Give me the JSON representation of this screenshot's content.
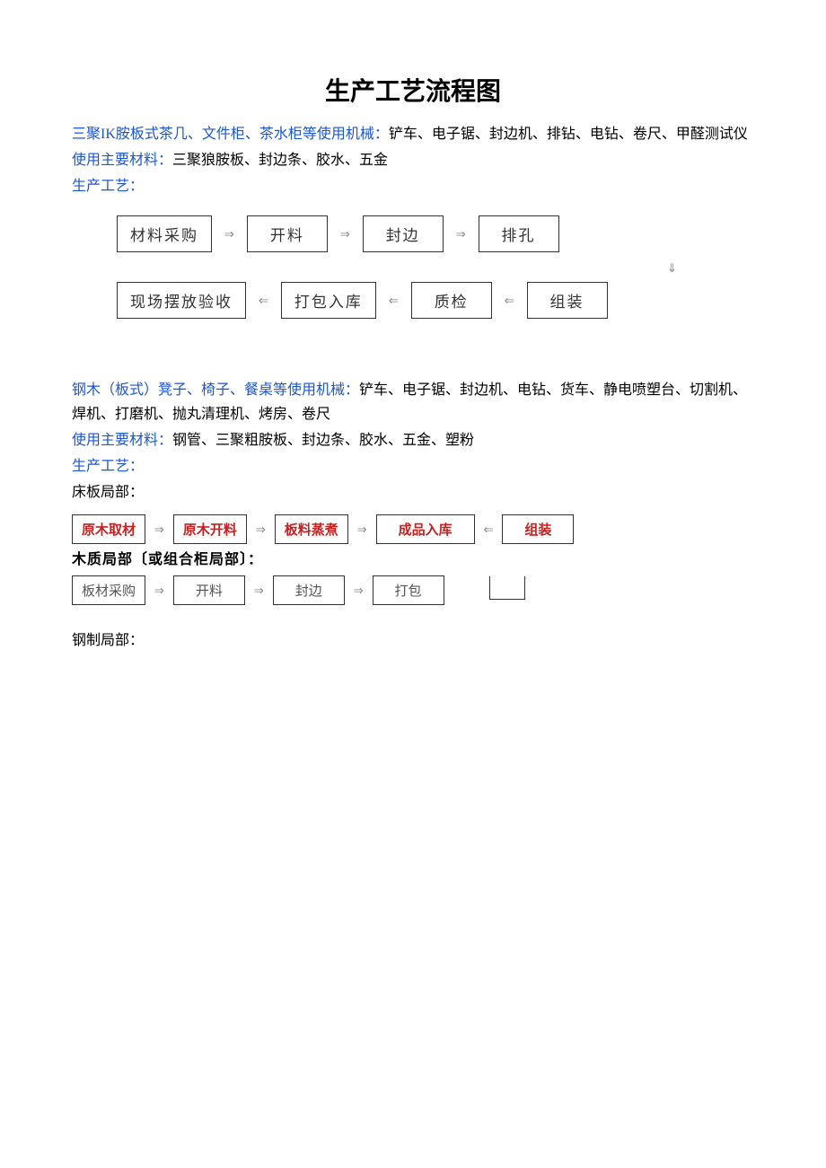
{
  "title": "生产工艺流程图",
  "section1": {
    "line1_blue": "三聚IK胺板式茶几、文件柜、茶水柜等使用机械：",
    "line1_rest": "铲车、电子锯、封边机、排钻、电钻、卷尺、甲醛测试仪",
    "line2_blue": "使用主要材料：",
    "line2_rest": "三聚狼胺板、封边条、胶水、五金",
    "line3_blue": "生产工艺：",
    "flow_top": [
      "材料采购",
      "开料",
      "封边",
      "排孔"
    ],
    "flow_bottom": [
      "现场摆放验收",
      "打包入库",
      "质检",
      "组装"
    ]
  },
  "section2": {
    "line1_blue": "钢木（板式）凳子、椅子、餐桌等使用机械：",
    "line1_rest": "铲车、电子锯、封边机、电钻、货车、静电喷塑台、切割机、焊机、打磨机、抛丸清理机、烤房、卷尺",
    "line2_blue": "使用主要材料：",
    "line2_rest": "钢管、三聚粗胺板、封边条、胶水、五金、塑粉",
    "line3_blue": "生产工艺：",
    "sub1": "床板局部：",
    "flow2_row1_left": [
      "原木取材",
      "原木开料",
      "板料蒸煮"
    ],
    "flow2_row1_right": [
      "成品入库",
      "组装"
    ],
    "sub2": "木质局部〔或组合柜局部〕：",
    "flow2_row2": [
      "板材采购",
      "开料",
      "封边",
      "打包"
    ],
    "sub3": "钢制局部："
  }
}
